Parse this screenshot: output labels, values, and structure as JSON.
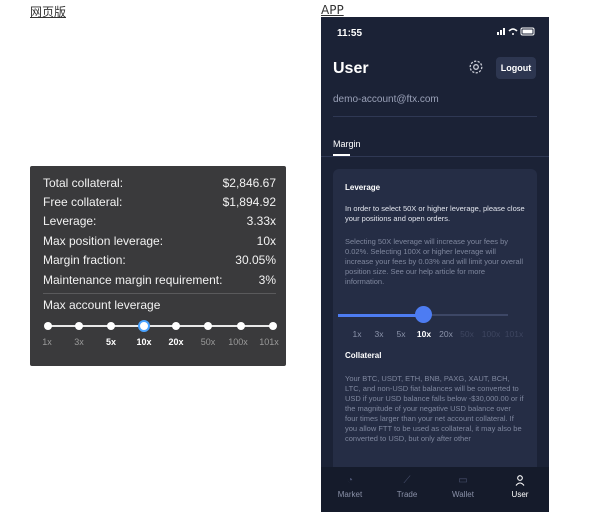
{
  "captions": {
    "web": "网页版",
    "app": "APP"
  },
  "web": {
    "rows": [
      {
        "label": "Total collateral:",
        "value": "$2,846.67"
      },
      {
        "label": "Free collateral:",
        "value": "$1,894.92"
      },
      {
        "label": "Leverage:",
        "value": "3.33x"
      },
      {
        "label": "Max position leverage:",
        "value": "10x"
      },
      {
        "label": "Margin fraction:",
        "value": "30.05%"
      },
      {
        "label": "Maintenance margin requirement:",
        "value": "3%"
      }
    ],
    "leverage_title": "Max account leverage",
    "ticks": [
      "1x",
      "3x",
      "5x",
      "10x",
      "20x",
      "50x",
      "100x",
      "101x"
    ],
    "selected": "10x",
    "accent": "#4aa3ff"
  },
  "app": {
    "status_time": "11:55",
    "status_icons": "signal wifi battery",
    "title": "User",
    "settings_icon": "gear-icon",
    "logout_label": "Logout",
    "email": "demo-account@ftx.com",
    "tab_label": "Margin",
    "leverage_heading": "Leverage",
    "leverage_text": "In order to select 50X or higher leverage, please close your positions and open orders.",
    "leverage_note": "Selecting 50X leverage will increase your fees by 0.02%. Selecting 100X or higher leverage will increase your fees by 0.03% and will limit your overall position size. See our help article for more information.",
    "ticks": [
      "1x",
      "3x",
      "5x",
      "10x",
      "20x",
      "50x",
      "100x",
      "101x"
    ],
    "selected": "10x",
    "collateral_heading": "Collateral",
    "collateral_text": "Your BTC, USDT, ETH, BNB, PAXG, XAUT, BCH, LTC, and non-USD fiat balances will be converted to USD if your USD balance falls below -$30,000.00 or if the magnitude of your negative USD balance over four times larger than your net account collateral. If you allow FTT to be used as collateral, it may also be converted to USD, but only after other",
    "tabbar": [
      {
        "label": "Market",
        "icon": "market-icon"
      },
      {
        "label": "Trade",
        "icon": "trade-icon"
      },
      {
        "label": "Wallet",
        "icon": "wallet-icon"
      },
      {
        "label": "User",
        "icon": "user-icon",
        "active": true
      }
    ],
    "accent": "#4d7cf2"
  }
}
